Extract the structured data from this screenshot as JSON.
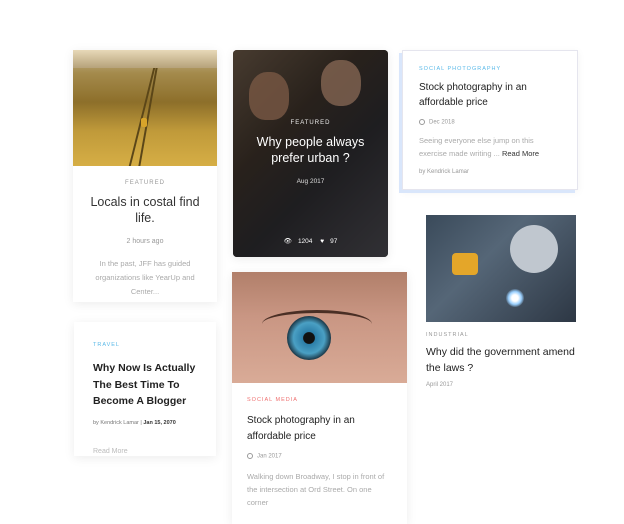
{
  "cards": [
    {
      "kicker": "FEATURED",
      "title": "Locals in costal find life.",
      "meta": "2 hours ago",
      "excerpt": "In the past, JFF has guided organizations like YearUp and Center..."
    },
    {
      "kicker": "FEATURED",
      "title": "Why people always prefer urban ?",
      "date": "Aug 2017",
      "views": "1204",
      "likes": "97"
    },
    {
      "kicker": "SOCIAL PHOTOGRAPHY",
      "title": "Stock photography in an affordable price",
      "meta": "Dec 2018",
      "excerpt": "Seeing everyone else jump on this exercise made writing ...",
      "more": "Read More",
      "by": "by  Kendrick Lamar"
    },
    {
      "kicker": "TRAVEL",
      "title": "Why Now Is Actually The Best Time To Become A Blogger",
      "author": "by  Kendrick Lamar | ",
      "date": "Jan 15, 2070",
      "read_more": "Read More"
    },
    {
      "kicker": "SOCIAL MEDIA",
      "title": "Stock photography in an affordable price",
      "meta": "Jan 2017",
      "excerpt": "Walking down Broadway, I stop in front of the intersection at Ord Street. On one corner"
    },
    {
      "kicker": "INDUSTRIAL",
      "title": "Why did the government amend the laws ?",
      "meta": "April 2017"
    }
  ],
  "icons": {
    "clock": "clock-icon",
    "eye": "eye-icon",
    "heart": "heart-icon"
  }
}
